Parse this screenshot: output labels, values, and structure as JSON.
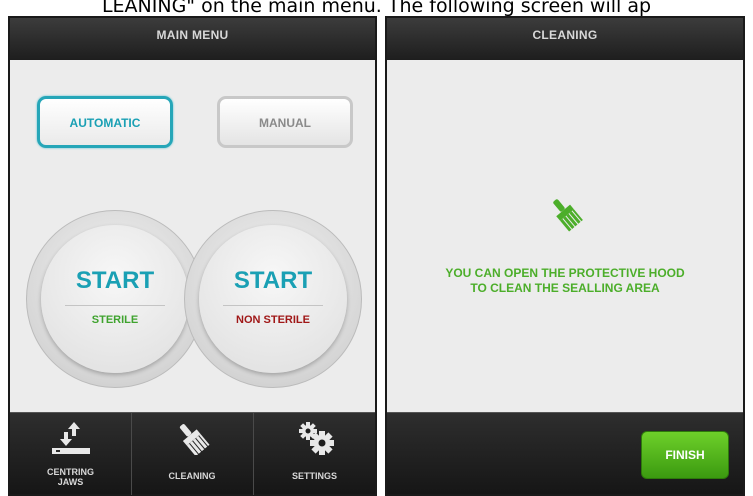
{
  "caption": "LEANING\" on the main menu. The following screen will ap",
  "main_screen": {
    "title": "MAIN MENU",
    "mode_buttons": {
      "automatic": "AUTOMATIC",
      "manual": "MANUAL"
    },
    "start_sterile": {
      "label": "START",
      "sub": "STERILE"
    },
    "start_nonsterile": {
      "label": "START",
      "sub": "NON STERILE"
    },
    "nav": {
      "centring_line1": "CENTRING",
      "centring_line2": "JAWS",
      "cleaning": "CLEANING",
      "settings": "SETTINGS"
    },
    "colors": {
      "accent": "#1aa0b4",
      "sterile": "#3fa32e",
      "non_sterile": "#a01818"
    }
  },
  "cleaning_screen": {
    "title": "CLEANING",
    "message_line1": "YOU CAN OPEN THE PROTECTIVE HOOD",
    "message_line2": "TO CLEAN THE SEALLING AREA",
    "finish_label": "FINISH",
    "icon": "brush-icon",
    "colors": {
      "message": "#4cae2a",
      "finish": "#4fb41a"
    }
  }
}
